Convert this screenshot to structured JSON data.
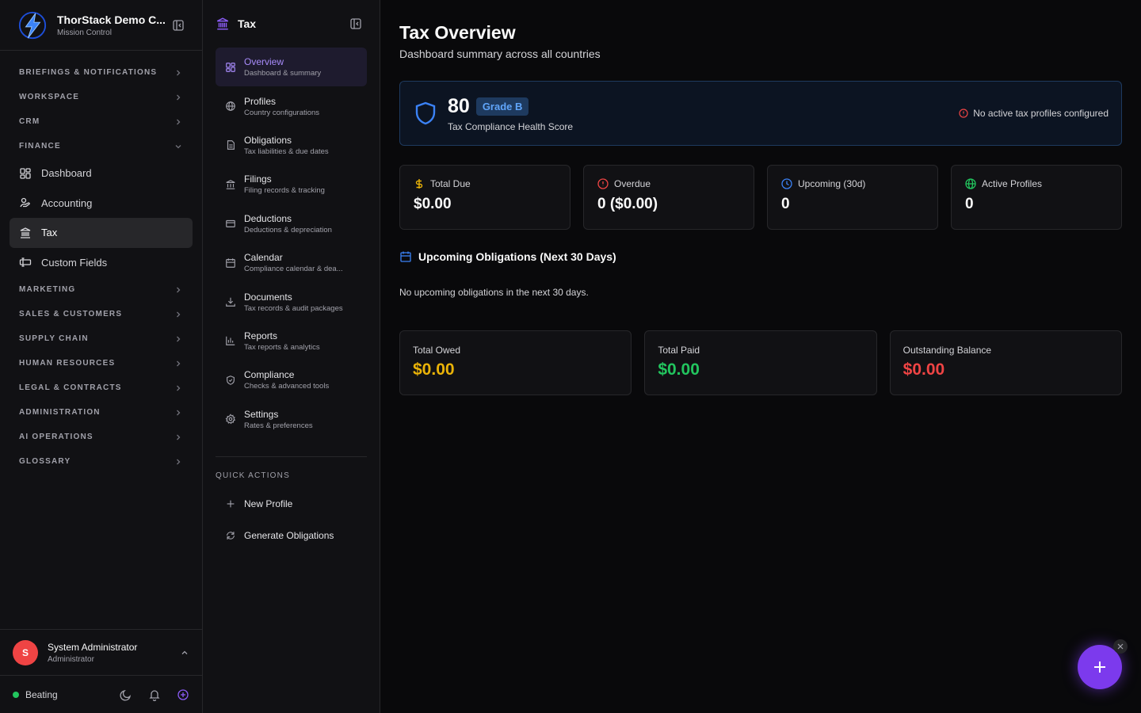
{
  "brand": {
    "name": "ThorStack Demo C...",
    "subtitle": "Mission Control"
  },
  "sidebar": {
    "sections_top": [
      {
        "label": "BRIEFINGS & NOTIFICATIONS"
      },
      {
        "label": "WORKSPACE"
      },
      {
        "label": "CRM"
      },
      {
        "label": "FINANCE"
      }
    ],
    "finance_items": [
      {
        "label": "Dashboard",
        "icon": "dashboard-icon"
      },
      {
        "label": "Accounting",
        "icon": "accounting-icon"
      },
      {
        "label": "Tax",
        "icon": "landmark-icon",
        "active": true
      },
      {
        "label": "Custom Fields",
        "icon": "custom-fields-icon"
      }
    ],
    "sections_bottom": [
      {
        "label": "MARKETING"
      },
      {
        "label": "SALES & CUSTOMERS"
      },
      {
        "label": "SUPPLY CHAIN"
      },
      {
        "label": "HUMAN RESOURCES"
      },
      {
        "label": "LEGAL & CONTRACTS"
      },
      {
        "label": "ADMINISTRATION"
      },
      {
        "label": "AI OPERATIONS"
      },
      {
        "label": "GLOSSARY"
      }
    ]
  },
  "user": {
    "initial": "S",
    "name": "System Administrator",
    "role": "Administrator"
  },
  "status": {
    "label": "Beating",
    "color": "#22c55e"
  },
  "subnav": {
    "title": "Tax",
    "items": [
      {
        "label": "Overview",
        "desc": "Dashboard & summary",
        "icon": "overview-icon",
        "active": true
      },
      {
        "label": "Profiles",
        "desc": "Country configurations",
        "icon": "globe-icon"
      },
      {
        "label": "Obligations",
        "desc": "Tax liabilities & due dates",
        "icon": "file-icon"
      },
      {
        "label": "Filings",
        "desc": "Filing records & tracking",
        "icon": "landmark-icon"
      },
      {
        "label": "Deductions",
        "desc": "Deductions & depreciation",
        "icon": "card-icon"
      },
      {
        "label": "Calendar",
        "desc": "Compliance calendar & dea...",
        "icon": "calendar-icon"
      },
      {
        "label": "Documents",
        "desc": "Tax records & audit packages",
        "icon": "download-icon"
      },
      {
        "label": "Reports",
        "desc": "Tax reports & analytics",
        "icon": "chart-icon"
      },
      {
        "label": "Compliance",
        "desc": "Checks & advanced tools",
        "icon": "shield-check-icon"
      },
      {
        "label": "Settings",
        "desc": "Rates & preferences",
        "icon": "gear-icon"
      }
    ],
    "quick_actions_title": "QUICK ACTIONS",
    "quick_actions": [
      {
        "label": "New Profile",
        "icon": "plus-icon"
      },
      {
        "label": "Generate Obligations",
        "icon": "refresh-icon"
      }
    ]
  },
  "main": {
    "title": "Tax Overview",
    "subtitle": "Dashboard summary across all countries",
    "health": {
      "score": "80",
      "grade": "Grade B",
      "label": "Tax Compliance Health Score",
      "warning": "No active tax profiles configured"
    },
    "stats": [
      {
        "label": "Total Due",
        "value": "$0.00",
        "icon": "dollar-icon",
        "color": "#eab308"
      },
      {
        "label": "Overdue",
        "value": "0 ($0.00)",
        "icon": "alert-circle-icon",
        "color": "#ef4444"
      },
      {
        "label": "Upcoming (30d)",
        "value": "0",
        "icon": "clock-icon",
        "color": "#3b82f6"
      },
      {
        "label": "Active Profiles",
        "value": "0",
        "icon": "globe-icon",
        "color": "#22c55e"
      }
    ],
    "upcoming": {
      "title": "Upcoming Obligations (Next 30 Days)",
      "empty": "No upcoming obligations in the next 30 days."
    },
    "totals": [
      {
        "label": "Total Owed",
        "value": "$0.00",
        "color": "#eab308"
      },
      {
        "label": "Total Paid",
        "value": "$0.00",
        "color": "#22c55e"
      },
      {
        "label": "Outstanding Balance",
        "value": "$0.00",
        "color": "#ef4444"
      }
    ]
  },
  "colors": {
    "accent": "#7c3aed",
    "info": "#3b82f6"
  }
}
